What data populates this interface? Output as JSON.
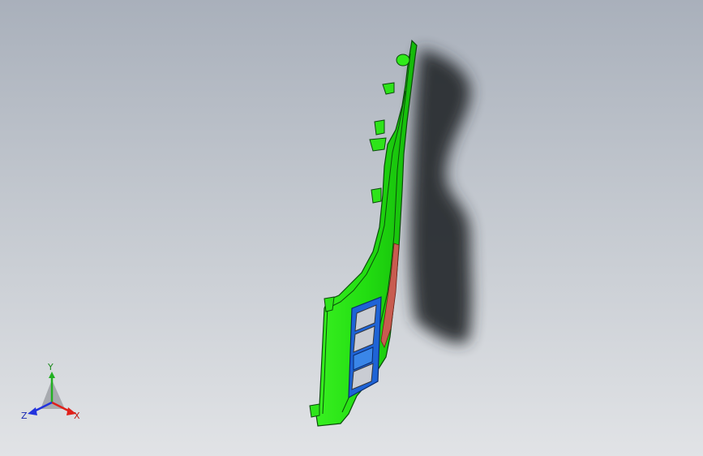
{
  "viewport": {
    "background_top": "#a9b0bb",
    "background_bottom": "#e1e3e6"
  },
  "model": {
    "body_color": "#22dd11",
    "edge_color": "#0b4a0b",
    "insert_color": "#1e63d6",
    "button_color": "#c9ccd3",
    "panel_color": "#c85c50",
    "shadow_color": "#2b2d31"
  },
  "triad": {
    "x_label": "X",
    "y_label": "Y",
    "z_label": "Z",
    "x_color": "#e0201a",
    "y_color": "#22b022",
    "z_color": "#2233dd"
  }
}
